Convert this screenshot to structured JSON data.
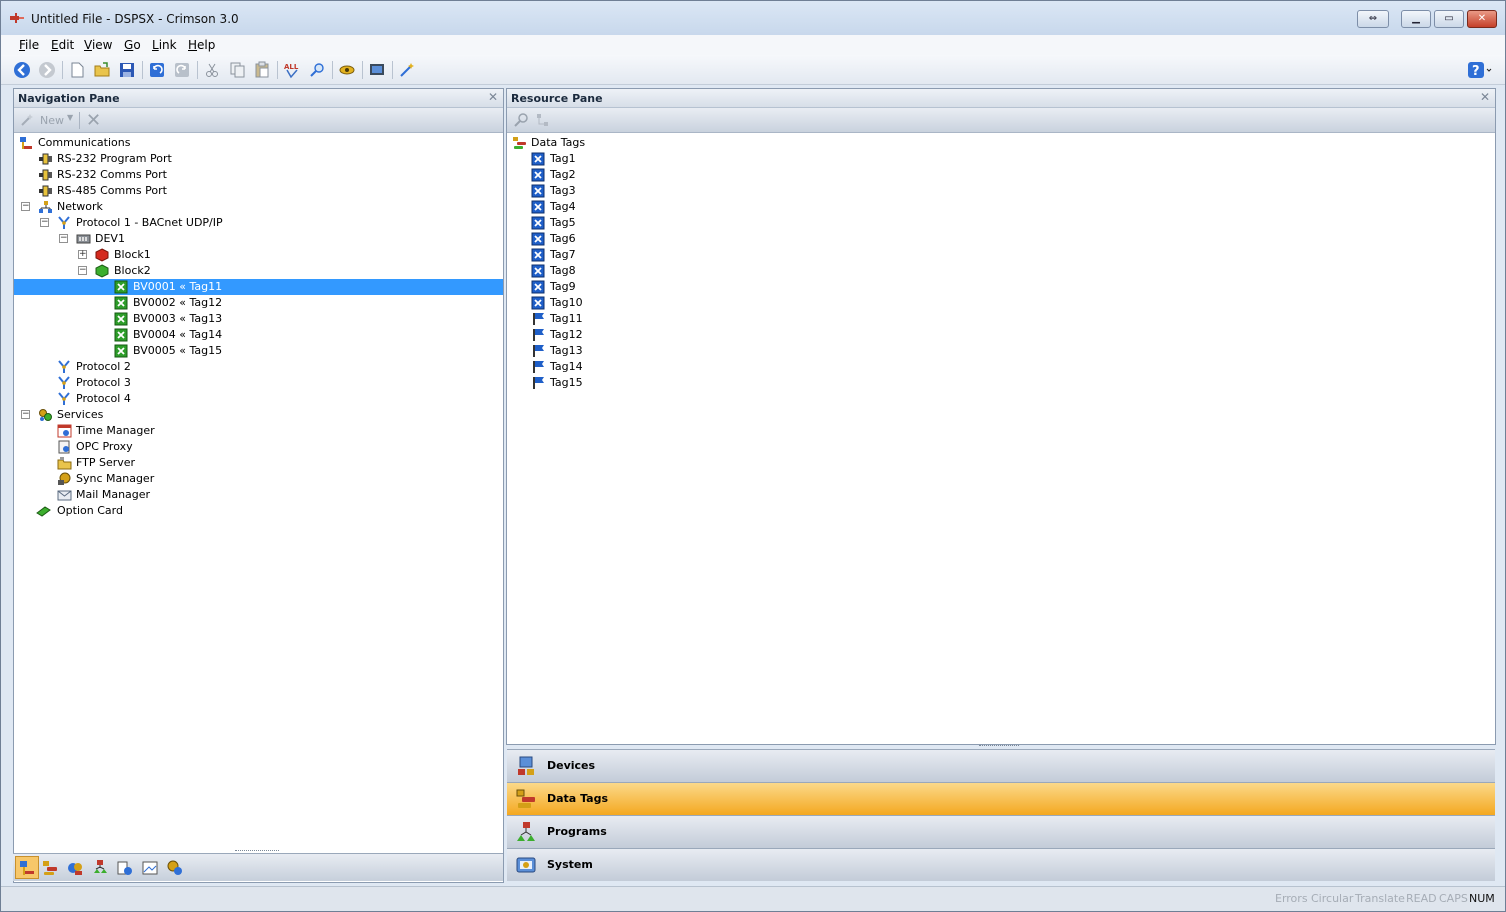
{
  "window": {
    "title": "Untitled File - DSPSX - Crimson 3.0"
  },
  "menu": [
    {
      "label": "File",
      "key": "F",
      "rest": "ile"
    },
    {
      "label": "Edit",
      "key": "E",
      "rest": "dit"
    },
    {
      "label": "View",
      "key": "V",
      "rest": "iew"
    },
    {
      "label": "Go",
      "key": "G",
      "rest": "o"
    },
    {
      "label": "Link",
      "key": "L",
      "rest": "ink"
    },
    {
      "label": "Help",
      "key": "H",
      "rest": "elp"
    }
  ],
  "navigation_pane": {
    "title": "Navigation Pane",
    "new_label": "New",
    "tree": [
      {
        "label": "Communications",
        "icon": "communications-icon"
      },
      {
        "label": "RS-232 Program Port",
        "icon": "port-icon"
      },
      {
        "label": "RS-232 Comms Port",
        "icon": "port-icon"
      },
      {
        "label": "RS-485 Comms Port",
        "icon": "port-icon"
      },
      {
        "label": "Network",
        "icon": "network-icon"
      },
      {
        "label": "Protocol 1 - BACnet UDP/IP",
        "icon": "protocol-icon"
      },
      {
        "label": "DEV1",
        "icon": "device-icon"
      },
      {
        "label": "Block1",
        "icon": "red-block-icon"
      },
      {
        "label": "Block2",
        "icon": "green-block-icon"
      },
      {
        "label": "BV0001 « Tag11",
        "icon": "green-tag-icon"
      },
      {
        "label": "BV0002 « Tag12",
        "icon": "green-tag-icon"
      },
      {
        "label": "BV0003 « Tag13",
        "icon": "green-tag-icon"
      },
      {
        "label": "BV0004 « Tag14",
        "icon": "green-tag-icon"
      },
      {
        "label": "BV0005 « Tag15",
        "icon": "green-tag-icon"
      },
      {
        "label": "Protocol 2",
        "icon": "protocol-icon"
      },
      {
        "label": "Protocol 3",
        "icon": "protocol-icon"
      },
      {
        "label": "Protocol 4",
        "icon": "protocol-icon"
      },
      {
        "label": "Services",
        "icon": "services-icon"
      },
      {
        "label": "Time Manager",
        "icon": "time-manager-icon"
      },
      {
        "label": "OPC Proxy",
        "icon": "opc-proxy-icon"
      },
      {
        "label": "FTP Server",
        "icon": "ftp-server-icon"
      },
      {
        "label": "Sync Manager",
        "icon": "sync-manager-icon"
      },
      {
        "label": "Mail Manager",
        "icon": "mail-manager-icon"
      },
      {
        "label": "Option Card",
        "icon": "option-card-icon"
      }
    ]
  },
  "resource_pane": {
    "title": "Resource Pane",
    "tree": [
      {
        "label": "Data Tags",
        "icon": "data-tags-icon"
      },
      {
        "label": "Tag1",
        "icon": "blue-tag-icon"
      },
      {
        "label": "Tag2",
        "icon": "blue-tag-icon"
      },
      {
        "label": "Tag3",
        "icon": "blue-tag-icon"
      },
      {
        "label": "Tag4",
        "icon": "blue-tag-icon"
      },
      {
        "label": "Tag5",
        "icon": "blue-tag-icon"
      },
      {
        "label": "Tag6",
        "icon": "blue-tag-icon"
      },
      {
        "label": "Tag7",
        "icon": "blue-tag-icon"
      },
      {
        "label": "Tag8",
        "icon": "blue-tag-icon"
      },
      {
        "label": "Tag9",
        "icon": "blue-tag-icon"
      },
      {
        "label": "Tag10",
        "icon": "blue-tag-icon"
      },
      {
        "label": "Tag11",
        "icon": "flag-tag-icon"
      },
      {
        "label": "Tag12",
        "icon": "flag-tag-icon"
      },
      {
        "label": "Tag13",
        "icon": "flag-tag-icon"
      },
      {
        "label": "Tag14",
        "icon": "flag-tag-icon"
      },
      {
        "label": "Tag15",
        "icon": "flag-tag-icon"
      }
    ]
  },
  "categories": [
    {
      "label": "Devices",
      "icon": "devices-icon"
    },
    {
      "label": "Data Tags",
      "icon": "data-tags-icon",
      "active": true
    },
    {
      "label": "Programs",
      "icon": "programs-icon"
    },
    {
      "label": "System",
      "icon": "system-icon"
    }
  ],
  "status": {
    "errors": "Errors",
    "circular": "Circular",
    "translate": "Translate",
    "read": "READ",
    "caps": "CAPS",
    "num": "NUM"
  },
  "colors": {
    "selection": "#3399ff",
    "active_category": "#f4a820"
  }
}
